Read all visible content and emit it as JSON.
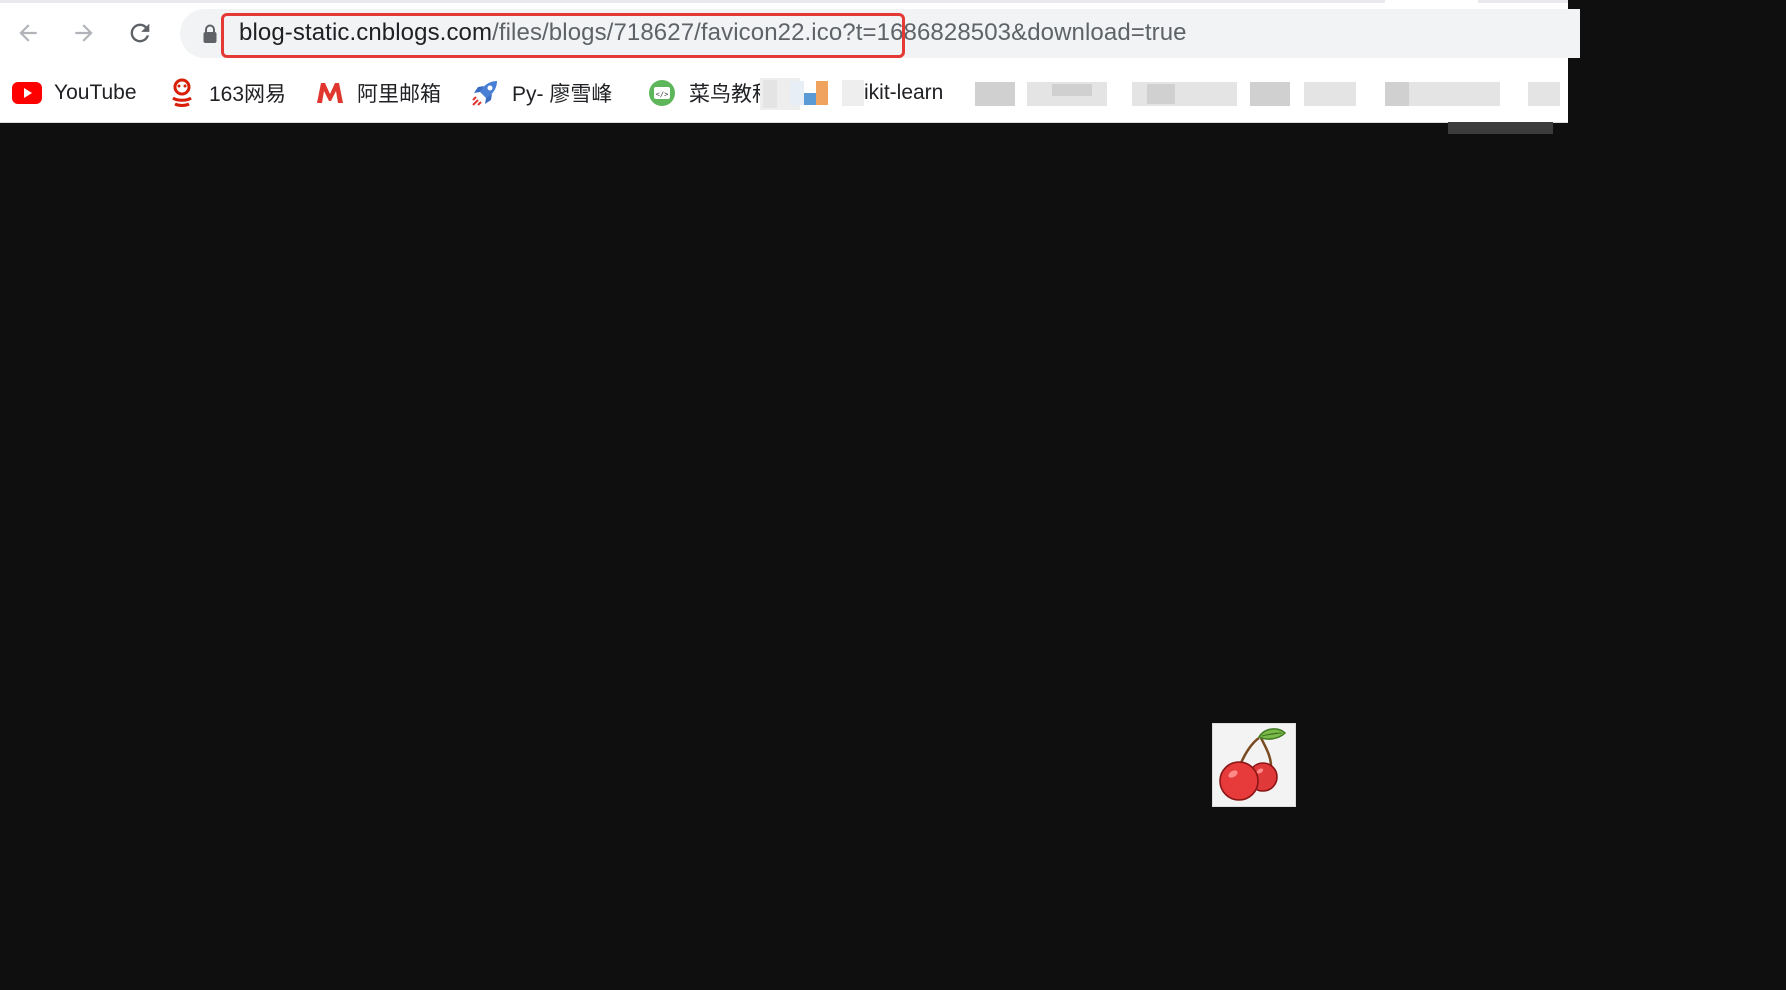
{
  "toolbar": {
    "back_icon": "arrow-left-icon",
    "forward_icon": "arrow-right-icon",
    "reload_icon": "reload-icon",
    "lock_icon": "lock-icon"
  },
  "address_bar": {
    "host": "blog-static.cnblogs.com",
    "path": "/files/blogs/718627/favicon22.ico",
    "query": "?t=1686828503&download=true",
    "highlight_color": "#e53935"
  },
  "bookmarks": [
    {
      "label": "YouTube",
      "icon": "youtube-icon"
    },
    {
      "label": "163网易",
      "icon": "netease-icon"
    },
    {
      "label": "阿里邮箱",
      "icon": "aliyun-mail-icon"
    },
    {
      "label": "Py- 廖雪峰",
      "icon": "rocket-icon"
    },
    {
      "label": "菜鸟教程",
      "icon": "runoob-icon"
    },
    {
      "label": "ikit-learn",
      "icon": "blurred-favicon"
    }
  ],
  "content": {
    "background": "#0f0f0f",
    "image": "cherry-favicon"
  }
}
